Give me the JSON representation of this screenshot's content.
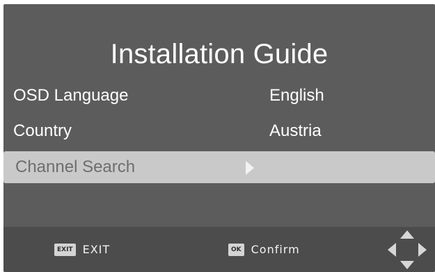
{
  "screen": {
    "title": "Installation Guide"
  },
  "menu": {
    "rows": [
      {
        "label": "OSD Language",
        "value": "English"
      },
      {
        "label": "Country",
        "value": "Austria"
      },
      {
        "label": "Channel Search",
        "value": ""
      }
    ],
    "selected_index": 2
  },
  "footer": {
    "exit_key": "EXIT",
    "exit_label": "EXIT",
    "ok_key": "OK",
    "ok_label": "Confirm",
    "nav_icon": "dpad-arrows-icon"
  },
  "colors": {
    "panel_bg": "#5c5c5c",
    "highlight_bg": "#c9c9c9",
    "footer_bg": "#4c4c4c",
    "text": "#ffffff"
  }
}
